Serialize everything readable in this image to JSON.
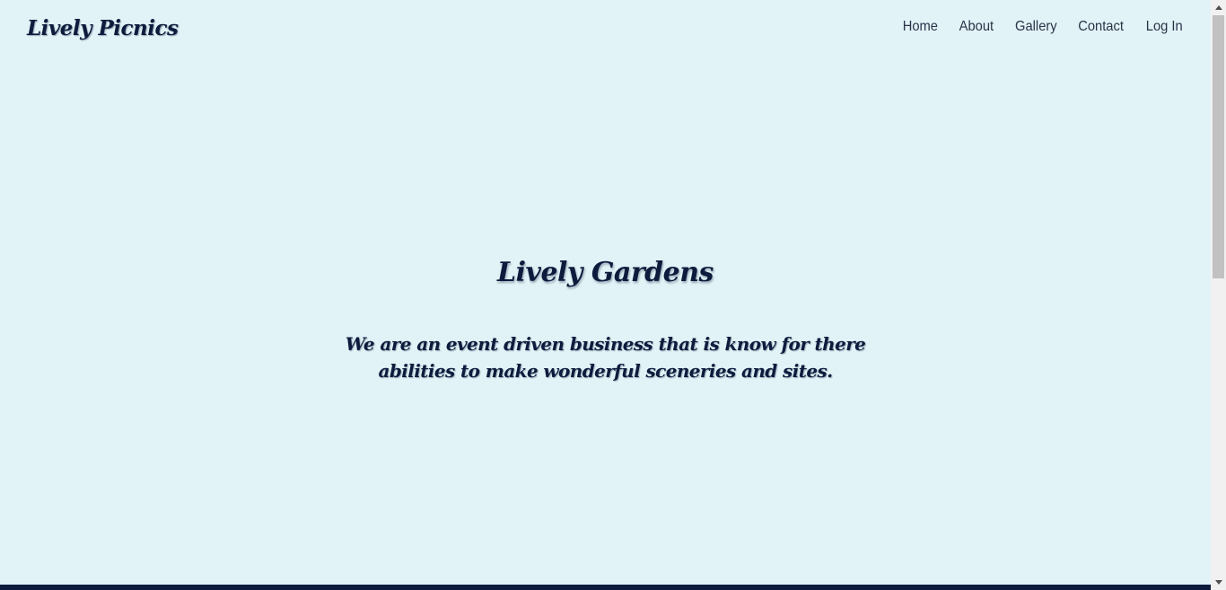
{
  "header": {
    "brand": "Lively Picnics",
    "nav": [
      {
        "label": "Home"
      },
      {
        "label": "About"
      },
      {
        "label": "Gallery"
      },
      {
        "label": "Contact"
      },
      {
        "label": "Log In"
      }
    ]
  },
  "hero": {
    "title": "Lively Gardens",
    "text": "We are an event driven business that is know for there abilities to make wonderful sceneries and sites."
  },
  "colors": {
    "background": "#e1f3f6",
    "text": "#0d1b3d",
    "nav_text": "#2a3348",
    "footer_bar": "#0d1b3d"
  },
  "icons": {
    "scroll_up": "triangle-up-icon",
    "scroll_down": "triangle-down-icon"
  }
}
